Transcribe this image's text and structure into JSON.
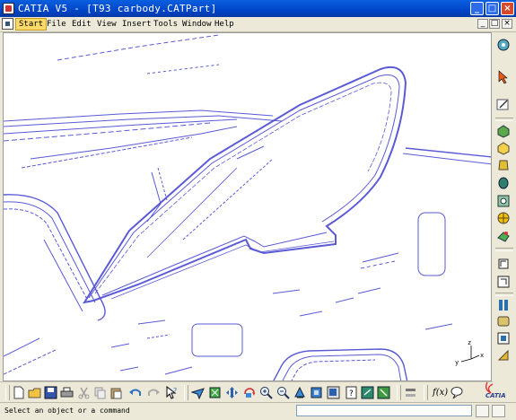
{
  "window": {
    "title": "CATIA V5 - [T93 carbody.CATPart]",
    "controls": [
      "_",
      "□",
      "×"
    ]
  },
  "menu": {
    "items": [
      "Start",
      "File",
      "Edit",
      "View",
      "Insert",
      "Tools",
      "Window",
      "Help"
    ],
    "active_item": "Start",
    "doc_controls": [
      "_",
      "□",
      "×"
    ]
  },
  "colors": {
    "titlebar": "#0a5fde",
    "wireframe": "#5a5ad6",
    "menu_highlight": "#f9d96a",
    "background": "#ece9d8"
  },
  "compass": {
    "x_label": "x",
    "y_label": "y",
    "z_label": "z"
  },
  "right_toolbar": {
    "icons": [
      "compass-icon",
      "select-icon",
      "sketcher-icon",
      "pad-icon",
      "pocket-icon",
      "shaft-icon",
      "groove-icon",
      "hole-icon",
      "rib-icon",
      "slot-icon",
      "stiffener-icon",
      "multi-section-icon",
      "fillet-icon",
      "chamfer-icon",
      "draft-icon",
      "shell-icon",
      "thickness-icon",
      "thread-icon"
    ]
  },
  "bottom_toolbar": {
    "icons": [
      "new-icon",
      "open-icon",
      "save-icon",
      "print-icon",
      "cut-icon",
      "copy-icon",
      "paste-icon",
      "undo-icon",
      "redo-icon",
      "whats-this-icon",
      "fly-mode-icon",
      "fit-all-icon",
      "pan-icon",
      "rotate-icon",
      "zoom-in-icon",
      "zoom-out-icon",
      "normal-view-icon",
      "views-icon",
      "render-style-icon",
      "hide-show-icon",
      "swap-space-icon",
      "update-icon",
      "formula-icon",
      "catia-logo-icon"
    ],
    "formula_label": "f(x)"
  },
  "status": {
    "message": "Select an object or a command",
    "command_value": ""
  },
  "logo_text": "CATIA"
}
